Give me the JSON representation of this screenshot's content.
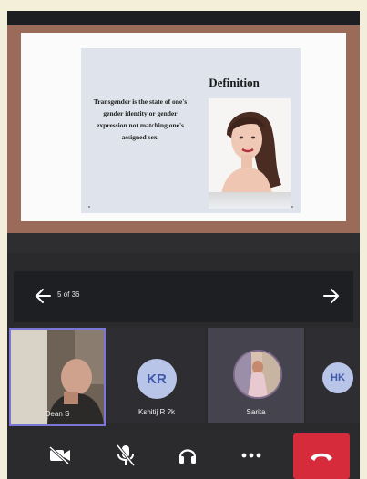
{
  "slide": {
    "title": "Definition",
    "body": "Transgender is the state of one's gender identity or gender expression not matching one's assigned sex."
  },
  "navigation": {
    "slide_counter": "5 of 36"
  },
  "participants": [
    {
      "name": "Dean S",
      "type": "video"
    },
    {
      "name": "Kshitij R ?k",
      "initials": "KR",
      "type": "initials"
    },
    {
      "name": "Sarita",
      "type": "photo"
    },
    {
      "initials": "HK",
      "type": "initials"
    }
  ],
  "controls": {
    "camera": "camera-off-icon",
    "mic": "mic-off-icon",
    "speaker": "speaker-icon",
    "more": "more-icon",
    "hangup": "hang-up-icon"
  },
  "colors": {
    "slide_frame": "#9a6b58",
    "hangup": "#d52b3a",
    "active_tile_border": "#7b77d6",
    "avatar_bg": "#b9c5e8",
    "avatar_text": "#3f58a8"
  }
}
